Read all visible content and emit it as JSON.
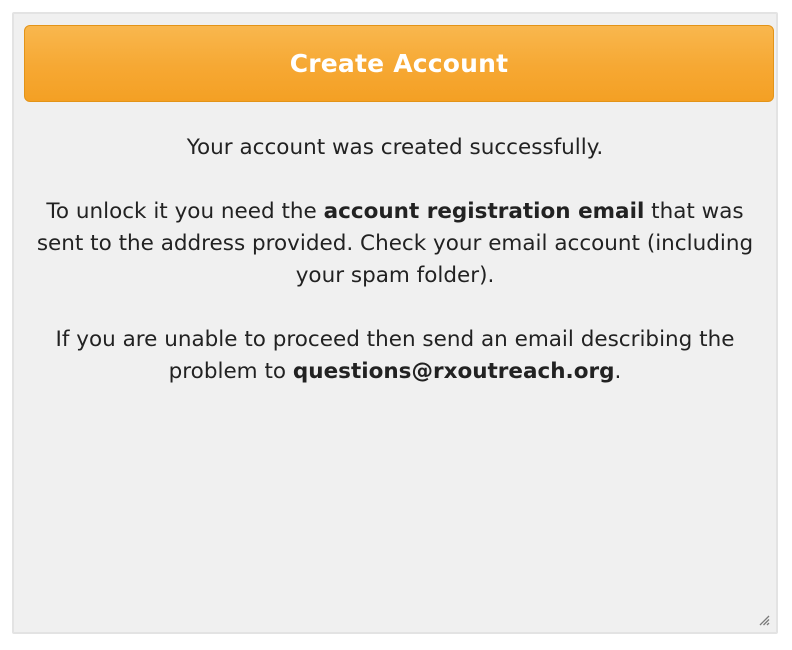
{
  "dialog": {
    "title": "Create Account",
    "success_message": "Your account was created successfully.",
    "unlock": {
      "prefix": "To unlock it you need the ",
      "emphasis": "account registration email",
      "suffix": " that was sent to the address provided. Check your email account (including your spam folder)."
    },
    "help": {
      "prefix": "If you are unable to proceed then send an email describing the problem to ",
      "email": "questions@rxoutreach.org",
      "suffix": "."
    }
  },
  "icons": {
    "resize_grip": "resize-grip-icon"
  },
  "colors": {
    "header_bg": "#f6a833",
    "header_text": "#ffffff",
    "panel_bg": "#f0f0f0",
    "text": "#222222"
  }
}
